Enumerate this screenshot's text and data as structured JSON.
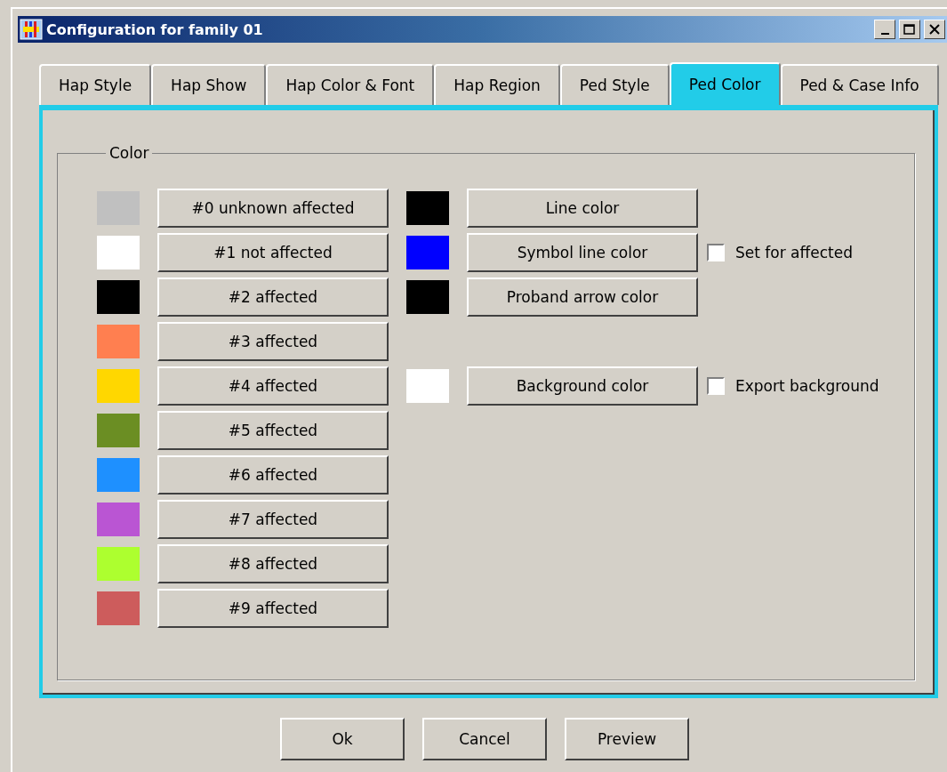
{
  "window": {
    "title": "Configuration for family 01"
  },
  "tabs": [
    {
      "label": "Hap Style",
      "selected": false
    },
    {
      "label": "Hap Show",
      "selected": false
    },
    {
      "label": "Hap Color & Font",
      "selected": false
    },
    {
      "label": "Hap Region",
      "selected": false
    },
    {
      "label": "Ped Style",
      "selected": false
    },
    {
      "label": "Ped Color",
      "selected": true
    },
    {
      "label": "Ped & Case Info",
      "selected": false
    }
  ],
  "group": {
    "title": "Color",
    "affection_colors": [
      {
        "label": "#0 unknown affected",
        "color": "#c0c0c0"
      },
      {
        "label": "#1 not affected",
        "color": "#ffffff"
      },
      {
        "label": "#2 affected",
        "color": "#000000"
      },
      {
        "label": "#3 affected",
        "color": "#ff7f50"
      },
      {
        "label": "#4 affected",
        "color": "#ffd700"
      },
      {
        "label": "#5 affected",
        "color": "#6b8e23"
      },
      {
        "label": "#6 affected",
        "color": "#1e90ff"
      },
      {
        "label": "#7 affected",
        "color": "#ba55d3"
      },
      {
        "label": "#8 affected",
        "color": "#adff2f"
      },
      {
        "label": "#9 affected",
        "color": "#cd5c5c"
      }
    ],
    "other_colors": [
      [
        {
          "label": "Line color",
          "color": "#000000"
        },
        {
          "label": "Symbol line color",
          "color": "#0000ff",
          "checkbox": {
            "label": "Set for affected",
            "checked": false
          }
        },
        {
          "label": "Proband arrow color",
          "color": "#000000"
        }
      ],
      [
        {
          "label": "Background color",
          "color": "#ffffff",
          "checkbox": {
            "label": "Export background",
            "checked": false
          }
        }
      ]
    ]
  },
  "buttons": [
    "Ok",
    "Cancel",
    "Preview"
  ]
}
